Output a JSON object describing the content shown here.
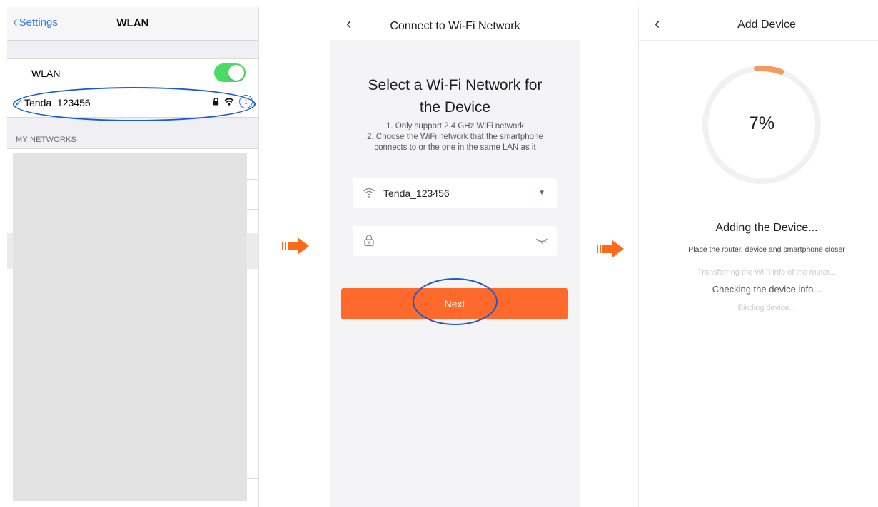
{
  "screen1": {
    "back_label": "Settings",
    "title": "WLAN",
    "wlan_label": "WLAN",
    "wlan_toggle": "on",
    "connected_network": "Tenda_123456",
    "check_mark": "✓",
    "info_glyph": "i",
    "section_header": "MY NETWORKS"
  },
  "screen2": {
    "back_glyph": "‹",
    "title": "Connect to Wi-Fi Network",
    "heading_line1": "Select a Wi-Fi Network for",
    "heading_line2": "the Device",
    "note_line1": "1. Only support 2.4 GHz WiFi network",
    "note_line2": "2. Choose the WiFi network that the smartphone",
    "note_line3": "connects to or the one in the same LAN as it",
    "network_value": "Tenda_123456",
    "dropdown_glyph": "▼",
    "password_value": "",
    "next_label": "Next"
  },
  "screen3": {
    "back_glyph": "‹",
    "title": "Add Device",
    "progress_percent": 7,
    "progress_label": "7%",
    "heading": "Adding the Device...",
    "subheading": "Place the router, device and smartphone closer",
    "steps": [
      {
        "label": "Transferring the WiFi info of the router...",
        "state": "done"
      },
      {
        "label": "Checking the device info...",
        "state": "active"
      },
      {
        "label": "Binding device...",
        "state": "pending"
      }
    ]
  },
  "colors": {
    "ios_blue": "#3478f6",
    "toggle_green": "#4cd964",
    "accent_orange": "#ff6a2c",
    "highlight_ellipse": "#1a5cc7",
    "progress_track": "#f1f1f1",
    "progress_fill": "#f29a60"
  }
}
